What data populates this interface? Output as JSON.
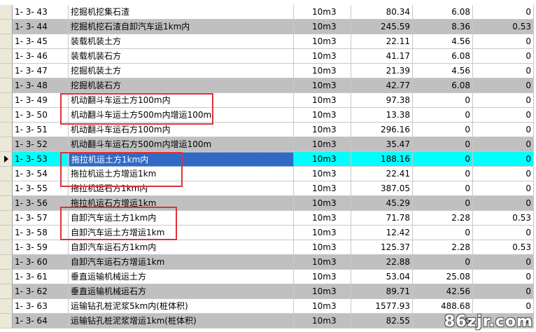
{
  "table": {
    "rows": [
      {
        "code": "1- 3- 43",
        "name": "挖掘机挖集石渣",
        "unit": "10m3",
        "v1": "80.34",
        "v2": "6.08",
        "v3": "0",
        "style": "white"
      },
      {
        "code": "1- 3- 44",
        "name": "挖掘机挖石渣自卸汽车运1km内",
        "unit": "10m3",
        "v1": "245.59",
        "v2": "8.36",
        "v3": "0.53",
        "style": "gray"
      },
      {
        "code": "1- 3- 45",
        "name": "装载机装土方",
        "unit": "10m3",
        "v1": "22.11",
        "v2": "4.56",
        "v3": "0",
        "style": "white"
      },
      {
        "code": "1- 3- 46",
        "name": "装载机装石方",
        "unit": "10m3",
        "v1": "41.17",
        "v2": "6.08",
        "v3": "0",
        "style": "white"
      },
      {
        "code": "1- 3- 47",
        "name": "挖掘机装土方",
        "unit": "10m3",
        "v1": "21.39",
        "v2": "4.56",
        "v3": "0",
        "style": "white"
      },
      {
        "code": "1- 3- 48",
        "name": "挖掘机装石方",
        "unit": "10m3",
        "v1": "42.77",
        "v2": "6.08",
        "v3": "0",
        "style": "gray"
      },
      {
        "code": "1- 3- 49",
        "name": "机动翻斗车运土方100m内",
        "unit": "10m3",
        "v1": "97.38",
        "v2": "0",
        "v3": "0",
        "style": "white"
      },
      {
        "code": "1- 3- 50",
        "name": "机动翻斗车运土方500m内增运100m",
        "unit": "10m3",
        "v1": "13.38",
        "v2": "0",
        "v3": "0",
        "style": "white"
      },
      {
        "code": "1- 3- 51",
        "name": "机动翻斗车运石方100m内",
        "unit": "10m3",
        "v1": "296.16",
        "v2": "0",
        "v3": "0",
        "style": "white"
      },
      {
        "code": "1- 3- 52",
        "name": "机动翻斗车运石方500m内增运100m",
        "unit": "10m3",
        "v1": "35.47",
        "v2": "0",
        "v3": "0",
        "style": "gray"
      },
      {
        "code": "1- 3- 53",
        "name": "拖拉机运土方1km内",
        "unit": "10m3",
        "v1": "188.16",
        "v2": "0",
        "v3": "0",
        "style": "selected"
      },
      {
        "code": "1- 3- 54",
        "name": "拖拉机运土方增运1km",
        "unit": "10m3",
        "v1": "22.41",
        "v2": "0",
        "v3": "0",
        "style": "white"
      },
      {
        "code": "1- 3- 55",
        "name": "拖拉机运石方1km内",
        "unit": "10m3",
        "v1": "387.05",
        "v2": "0",
        "v3": "0",
        "style": "white"
      },
      {
        "code": "1- 3- 56",
        "name": "拖拉机运石方增运1km",
        "unit": "10m3",
        "v1": "45.29",
        "v2": "0",
        "v3": "0",
        "style": "gray"
      },
      {
        "code": "1- 3- 57",
        "name": "自卸汽车运土方1km内",
        "unit": "10m3",
        "v1": "71.78",
        "v2": "2.28",
        "v3": "0.53",
        "style": "white"
      },
      {
        "code": "1- 3- 58",
        "name": "自卸汽车运土方增运1km",
        "unit": "10m3",
        "v1": "12.42",
        "v2": "0",
        "v3": "0",
        "style": "white"
      },
      {
        "code": "1- 3- 59",
        "name": "自卸汽车运石方1km内",
        "unit": "10m3",
        "v1": "125.37",
        "v2": "2.28",
        "v3": "0.53",
        "style": "white"
      },
      {
        "code": "1- 3- 60",
        "name": "自卸汽车运石方增运1km",
        "unit": "10m3",
        "v1": "22.88",
        "v2": "0",
        "v3": "0",
        "style": "gray"
      },
      {
        "code": "1- 3- 61",
        "name": "垂直运输机械运土方",
        "unit": "10m3",
        "v1": "53.04",
        "v2": "25.08",
        "v3": "0",
        "style": "white"
      },
      {
        "code": "1- 3- 62",
        "name": "垂直运输机械运石方",
        "unit": "10m3",
        "v1": "89.71",
        "v2": "42.56",
        "v3": "0",
        "style": "gray"
      },
      {
        "code": "1- 3- 63",
        "name": "运输钻孔桩泥浆5km内(桩体积)",
        "unit": "10m3",
        "v1": "1577.93",
        "v2": "488.68",
        "v3": "0",
        "style": "white"
      },
      {
        "code": "1- 3- 64",
        "name": "运输钻孔桩泥浆增运1km(桩体积)",
        "unit": "10m3",
        "v1": "82.55",
        "v2": "0",
        "v3": "0",
        "style": "gray"
      }
    ]
  },
  "selected_row_marker": "row-pointer-icon",
  "highlight_color": "#e0303a",
  "selection_color": "#00ffff",
  "watermark": "86zjr.com"
}
